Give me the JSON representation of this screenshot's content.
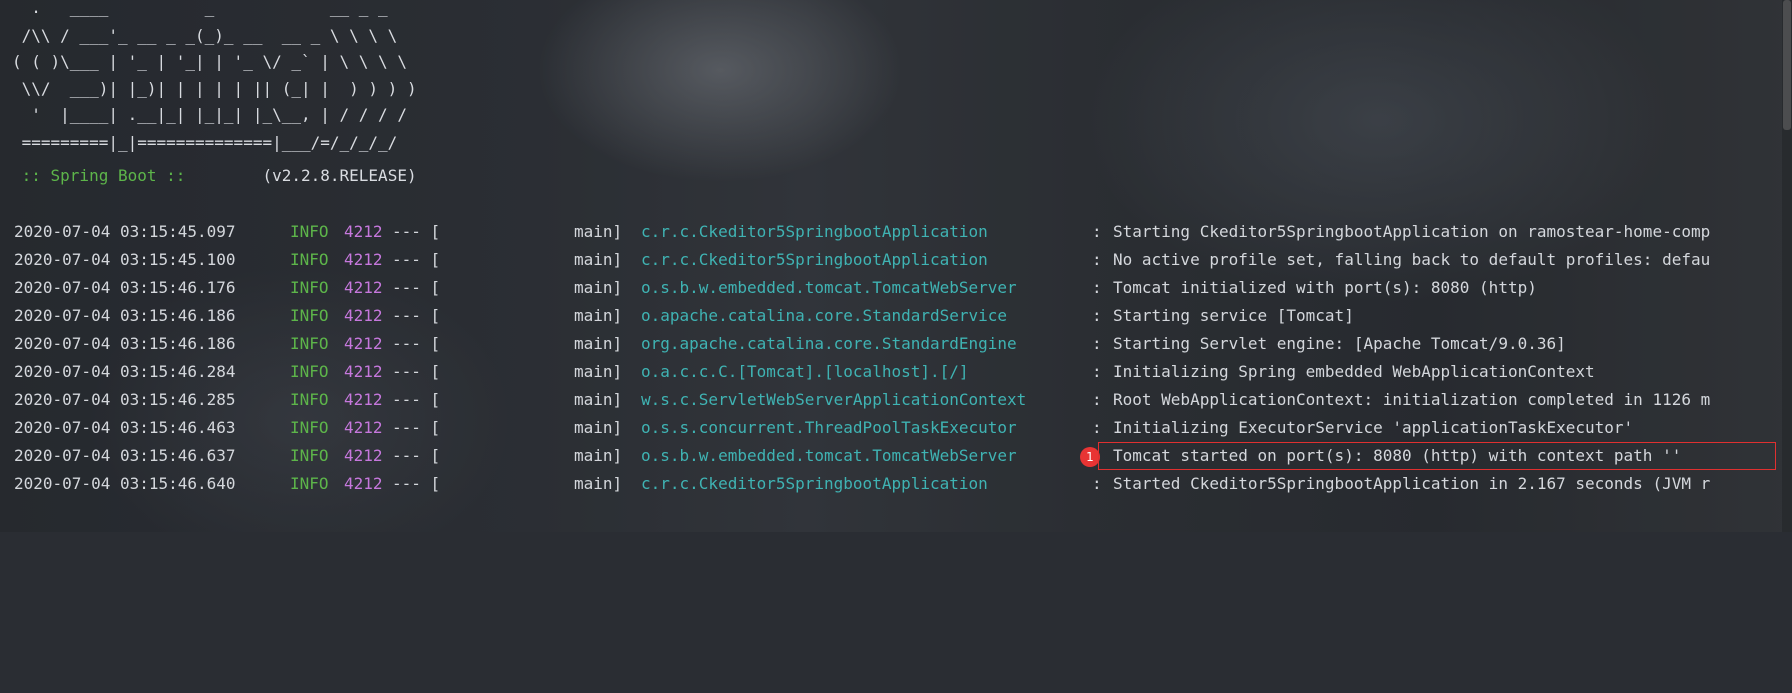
{
  "banner": {
    "lines": [
      "  .   ____          _            __ _ _",
      " /\\\\ / ___'_ __ _ _(_)_ __  __ _ \\ \\ \\ \\",
      "( ( )\\___ | '_ | '_| | '_ \\/ _` | \\ \\ \\ \\",
      " \\\\/  ___)| |_)| | | | | || (_| |  ) ) ) )",
      "  '  |____| .__|_| |_|_| |_\\__, | / / / /",
      " =========|_|==============|___/=/_/_/_/"
    ],
    "spring_label": " :: Spring Boot :: ",
    "version": "       (v2.2.8.RELEASE)"
  },
  "log": [
    {
      "ts": "2020-07-04 03:15:45.097",
      "level": "INFO",
      "pid": "4212",
      "sep": "--- [",
      "thread": "main]",
      "logger": "c.r.c.Ckeditor5SpringbootApplication",
      "msg": "Starting Ckeditor5SpringbootApplication on ramostear-home-comp"
    },
    {
      "ts": "2020-07-04 03:15:45.100",
      "level": "INFO",
      "pid": "4212",
      "sep": "--- [",
      "thread": "main]",
      "logger": "c.r.c.Ckeditor5SpringbootApplication",
      "msg": "No active profile set, falling back to default profiles: defau"
    },
    {
      "ts": "2020-07-04 03:15:46.176",
      "level": "INFO",
      "pid": "4212",
      "sep": "--- [",
      "thread": "main]",
      "logger": "o.s.b.w.embedded.tomcat.TomcatWebServer",
      "msg": "Tomcat initialized with port(s): 8080 (http)"
    },
    {
      "ts": "2020-07-04 03:15:46.186",
      "level": "INFO",
      "pid": "4212",
      "sep": "--- [",
      "thread": "main]",
      "logger": "o.apache.catalina.core.StandardService",
      "msg": "Starting service [Tomcat]"
    },
    {
      "ts": "2020-07-04 03:15:46.186",
      "level": "INFO",
      "pid": "4212",
      "sep": "--- [",
      "thread": "main]",
      "logger": "org.apache.catalina.core.StandardEngine",
      "msg": "Starting Servlet engine: [Apache Tomcat/9.0.36]"
    },
    {
      "ts": "2020-07-04 03:15:46.284",
      "level": "INFO",
      "pid": "4212",
      "sep": "--- [",
      "thread": "main]",
      "logger": "o.a.c.c.C.[Tomcat].[localhost].[/]",
      "msg": "Initializing Spring embedded WebApplicationContext"
    },
    {
      "ts": "2020-07-04 03:15:46.285",
      "level": "INFO",
      "pid": "4212",
      "sep": "--- [",
      "thread": "main]",
      "logger": "w.s.c.ServletWebServerApplicationContext",
      "msg": "Root WebApplicationContext: initialization completed in 1126 m"
    },
    {
      "ts": "2020-07-04 03:15:46.463",
      "level": "INFO",
      "pid": "4212",
      "sep": "--- [",
      "thread": "main]",
      "logger": "o.s.s.concurrent.ThreadPoolTaskExecutor",
      "msg": "Initializing ExecutorService 'applicationTaskExecutor'"
    },
    {
      "ts": "2020-07-04 03:15:46.637",
      "level": "INFO",
      "pid": "4212",
      "sep": "--- [",
      "thread": "main]",
      "logger": "o.s.b.w.embedded.tomcat.TomcatWebServer",
      "msg": "Tomcat started on port(s): 8080 (http) with context path ''"
    },
    {
      "ts": "2020-07-04 03:15:46.640",
      "level": "INFO",
      "pid": "4212",
      "sep": "--- [",
      "thread": "main]",
      "logger": "c.r.c.Ckeditor5SpringbootApplication",
      "msg": "Started Ckeditor5SpringbootApplication in 2.167 seconds (JVM r"
    }
  ],
  "annotation": {
    "badge": "1"
  },
  "colors": {
    "info": "#5db54a",
    "pid": "#c678dd",
    "logger": "#3fb3b3",
    "highlight": "#e03030"
  }
}
